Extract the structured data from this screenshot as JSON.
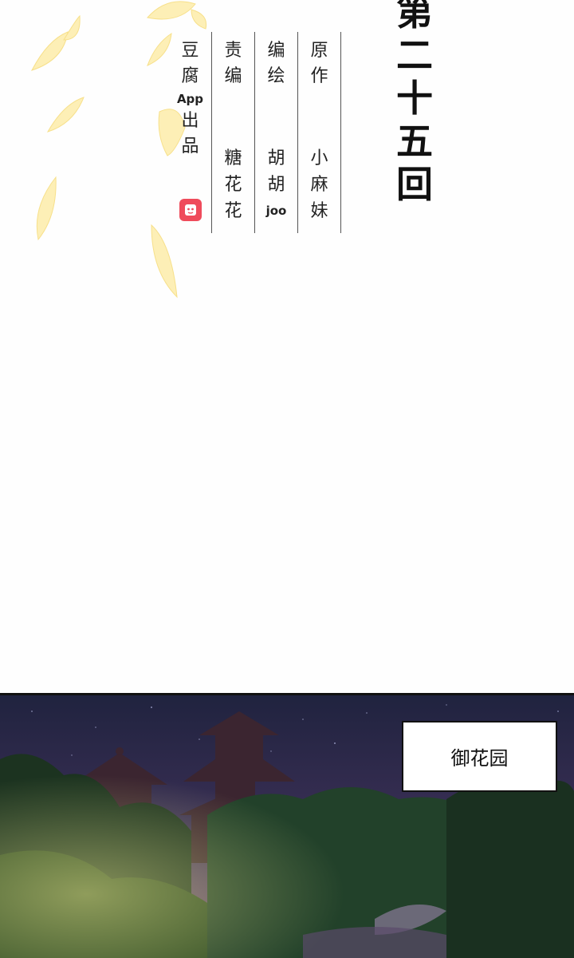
{
  "episode": {
    "chars": [
      "第",
      "二",
      "十",
      "五",
      "回"
    ]
  },
  "credits": {
    "publisher": {
      "label_chars": [
        "豆",
        "腐"
      ],
      "app_text": "App",
      "suffix_chars": [
        "出",
        "品"
      ],
      "logo_icon": "doufu-app-logo-icon",
      "logo_color": "#ef4b5b"
    },
    "editor": {
      "label_chars": [
        "责",
        "编"
      ],
      "name_chars": [
        "糖",
        "花",
        "花"
      ]
    },
    "artist": {
      "label_chars": [
        "编",
        "绘"
      ],
      "name_chars": [
        "胡",
        "胡"
      ],
      "name_latin": "joo"
    },
    "original": {
      "label_chars": [
        "原",
        "作"
      ],
      "name_chars": [
        "小",
        "麻",
        "妹"
      ]
    }
  },
  "scene": {
    "location": "御花园",
    "sky_color": "#2a2646",
    "foliage_color": "#1f3a22",
    "leaf_color": "#fdeeb0"
  }
}
